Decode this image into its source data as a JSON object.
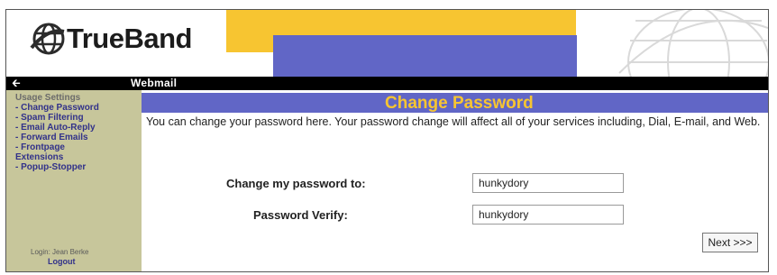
{
  "brand": {
    "logo_text": "TrueBand"
  },
  "topbar": {
    "title": "Webmail"
  },
  "sidebar": {
    "items": [
      {
        "label": "Usage Settings"
      },
      {
        "label": "- Change Password"
      },
      {
        "label": "- Spam Filtering"
      },
      {
        "label": "- Email Auto-Reply"
      },
      {
        "label": "- Forward Emails"
      },
      {
        "label": "- Frontpage"
      },
      {
        "label": "Extensions"
      },
      {
        "label": "- Popup-Stopper"
      }
    ],
    "login_text": "Login: Jean Berke",
    "logout_label": "Logout"
  },
  "main": {
    "title": "Change Password",
    "description": "You can change your password here. Your password change will affect all of your services including, Dial, E-mail, and Web.",
    "new_password_label": "Change my password to:",
    "new_password_value": "hunkydory",
    "verify_label": "Password Verify:",
    "verify_value": "hunkydory",
    "next_label": "Next >>>"
  },
  "colors": {
    "accent_purple": "#6166c6",
    "accent_gold": "#f7c531",
    "sidebar_bg": "#c7c69b"
  }
}
